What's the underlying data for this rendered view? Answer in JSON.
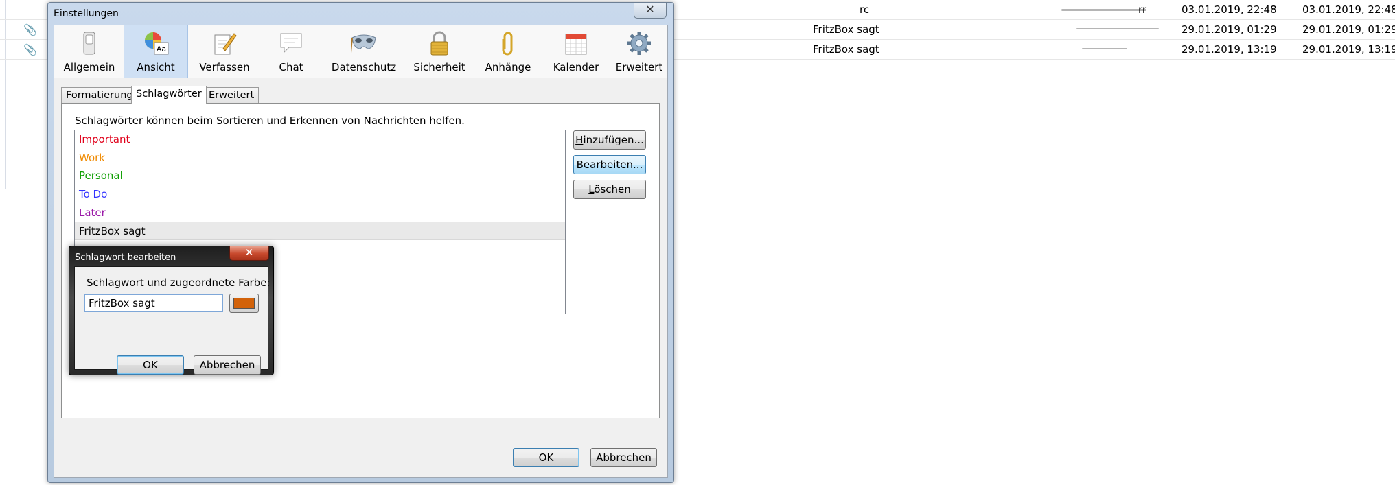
{
  "background_list": {
    "rows": [
      {
        "has_attachment": false,
        "subject_fragment": "rc",
        "sender": "",
        "col3_fragment": "rr",
        "date": "03.01.2019, 22:48",
        "received": "03.01.2019, 22:48"
      },
      {
        "has_attachment": true,
        "subject_fragment": "",
        "sender": "FritzBox sagt",
        "col3_fragment": "",
        "date": "29.01.2019, 01:29",
        "received": "29.01.2019, 01:29"
      },
      {
        "has_attachment": true,
        "subject_fragment": "",
        "sender": "FritzBox sagt",
        "col3_fragment": "",
        "date": "29.01.2019, 13:19",
        "received": "29.01.2019, 13:19"
      }
    ],
    "attachment_glyph": "📎",
    "attachment_icon": "paperclip-icon"
  },
  "dialog": {
    "title": "Einstellungen",
    "close_glyph": "✕",
    "toolbar": [
      {
        "label": "Allgemein",
        "icon": "switch-icon"
      },
      {
        "label": "Ansicht",
        "icon": "color-font-icon",
        "active": true
      },
      {
        "label": "Verfassen",
        "icon": "compose-icon"
      },
      {
        "label": "Chat",
        "icon": "chat-bubble-icon"
      },
      {
        "label": "Datenschutz",
        "icon": "mask-icon"
      },
      {
        "label": "Sicherheit",
        "icon": "lock-icon"
      },
      {
        "label": "Anhänge",
        "icon": "paperclip-icon"
      },
      {
        "label": "Kalender",
        "icon": "calendar-icon"
      },
      {
        "label": "Erweitert",
        "icon": "gear-icon"
      }
    ],
    "subtabs": [
      {
        "label": "Formatierung"
      },
      {
        "label": "Schlagwörter",
        "active": true
      },
      {
        "label": "Erweitert"
      }
    ],
    "description": "Schlagwörter können beim Sortieren und Erkennen von Nachrichten helfen.",
    "tags": [
      {
        "label": "Important",
        "color": "#e0001a"
      },
      {
        "label": "Work",
        "color": "#f08a00"
      },
      {
        "label": "Personal",
        "color": "#0d9e00"
      },
      {
        "label": "To Do",
        "color": "#3333ff"
      },
      {
        "label": "Later",
        "color": "#9b1aa8"
      },
      {
        "label": "FritzBox sagt",
        "color": "#000000",
        "selected": true
      }
    ],
    "side_buttons": {
      "add": {
        "underline": "H",
        "rest": "inzufügen..."
      },
      "edit": {
        "underline": "B",
        "rest": "earbeiten..."
      },
      "delete": {
        "underline": "L",
        "rest": "öschen"
      }
    },
    "ok_label": "OK",
    "cancel_label": "Abbrechen"
  },
  "edit_dialog": {
    "title": "Schlagwort bearbeiten",
    "close_glyph": "✕",
    "label_underline": "S",
    "label_rest": "chlagwort und zugeordnete Farbe:",
    "input_value": "FritzBox sagt",
    "color": "#d2620a",
    "ok_label": "OK",
    "cancel_label": "Abbrechen"
  }
}
